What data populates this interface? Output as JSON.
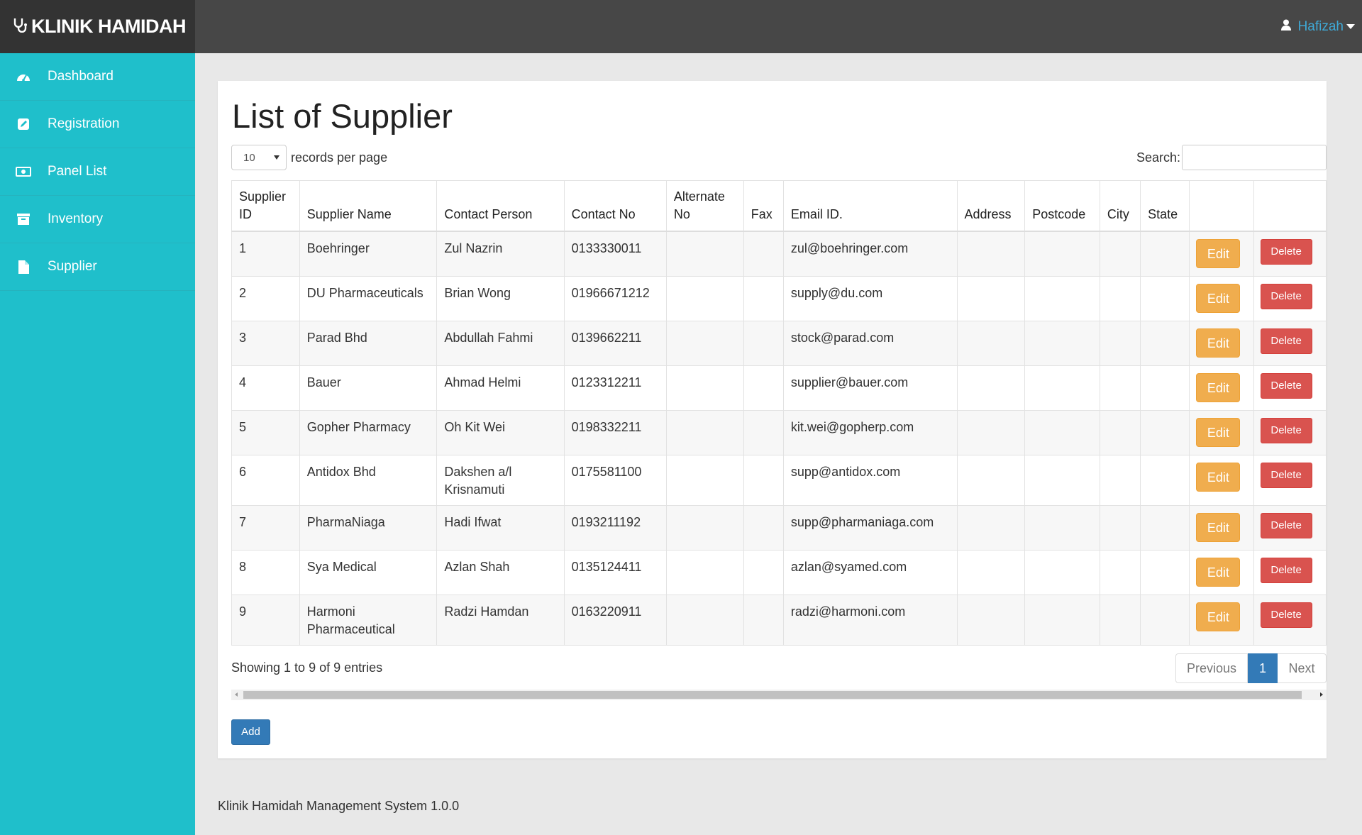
{
  "app": {
    "brand": "KLINIK HAMIDAH",
    "user": "Hafizah"
  },
  "sidebar": {
    "items": [
      {
        "label": "Dashboard",
        "icon": "dashboard-icon"
      },
      {
        "label": "Registration",
        "icon": "edit-icon"
      },
      {
        "label": "Panel List",
        "icon": "money-icon"
      },
      {
        "label": "Inventory",
        "icon": "archive-icon"
      },
      {
        "label": "Supplier",
        "icon": "file-icon"
      }
    ]
  },
  "main": {
    "title": "List of Supplier",
    "length_value": "10",
    "length_suffix": "records per page",
    "search_label": "Search:",
    "search_value": "",
    "columns": [
      "Supplier ID",
      "Supplier Name",
      "Contact Person",
      "Contact No",
      "Alternate No",
      "Fax",
      "Email ID.",
      "Address",
      "Postcode",
      "City",
      "State",
      "",
      ""
    ],
    "rows": [
      {
        "id": "1",
        "name": "Boehringer",
        "contact": "Zul Nazrin",
        "phone": "0133330011",
        "alt": "",
        "fax": "",
        "email": "zul@boehringer.com",
        "address": "",
        "postcode": "",
        "city": "",
        "state": ""
      },
      {
        "id": "2",
        "name": "DU Pharmaceuticals",
        "contact": "Brian Wong",
        "phone": "01966671212",
        "alt": "",
        "fax": "",
        "email": "supply@du.com",
        "address": "",
        "postcode": "",
        "city": "",
        "state": ""
      },
      {
        "id": "3",
        "name": "Parad Bhd",
        "contact": "Abdullah Fahmi",
        "phone": "0139662211",
        "alt": "",
        "fax": "",
        "email": "stock@parad.com",
        "address": "",
        "postcode": "",
        "city": "",
        "state": ""
      },
      {
        "id": "4",
        "name": "Bauer",
        "contact": "Ahmad Helmi",
        "phone": "0123312211",
        "alt": "",
        "fax": "",
        "email": "supplier@bauer.com",
        "address": "",
        "postcode": "",
        "city": "",
        "state": ""
      },
      {
        "id": "5",
        "name": "Gopher Pharmacy",
        "contact": "Oh Kit Wei",
        "phone": "0198332211",
        "alt": "",
        "fax": "",
        "email": "kit.wei@gopherp.com",
        "address": "",
        "postcode": "",
        "city": "",
        "state": ""
      },
      {
        "id": "6",
        "name": "Antidox Bhd",
        "contact": "Dakshen a/l Krisnamuti",
        "phone": "0175581100",
        "alt": "",
        "fax": "",
        "email": "supp@antidox.com",
        "address": "",
        "postcode": "",
        "city": "",
        "state": ""
      },
      {
        "id": "7",
        "name": "PharmaNiaga",
        "contact": "Hadi Ifwat",
        "phone": "0193211192",
        "alt": "",
        "fax": "",
        "email": "supp@pharmaniaga.com",
        "address": "",
        "postcode": "",
        "city": "",
        "state": ""
      },
      {
        "id": "8",
        "name": "Sya Medical",
        "contact": "Azlan Shah",
        "phone": "0135124411",
        "alt": "",
        "fax": "",
        "email": "azlan@syamed.com",
        "address": "",
        "postcode": "",
        "city": "",
        "state": ""
      },
      {
        "id": "9",
        "name": "Harmoni Pharmaceutical",
        "contact": "Radzi Hamdan",
        "phone": "0163220911",
        "alt": "",
        "fax": "",
        "email": "radzi@harmoni.com",
        "address": "",
        "postcode": "",
        "city": "",
        "state": ""
      }
    ],
    "edit_label": "Edit",
    "delete_label": "Delete",
    "info": "Showing 1 to 9 of 9 entries",
    "pager": {
      "previous": "Previous",
      "current": "1",
      "next": "Next"
    },
    "add_label": "Add"
  },
  "footer": {
    "text": "Klinik Hamidah Management System 1.0.0"
  },
  "colors": {
    "sidebar": "#1fbfcb",
    "topbar": "#474747",
    "brand_bg": "#333333",
    "edit": "#f0ad4e",
    "delete": "#d9534f",
    "primary": "#337ab7"
  }
}
